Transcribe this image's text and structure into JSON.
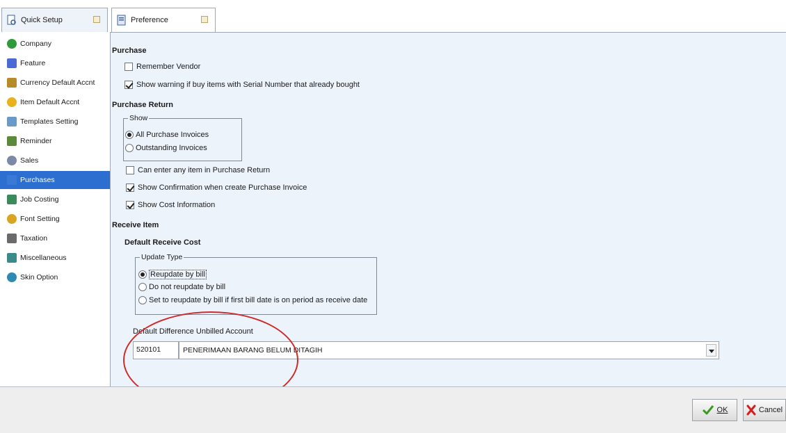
{
  "tabs": [
    {
      "label": "Quick Setup",
      "icon": "quick-setup-icon"
    },
    {
      "label": "Preference",
      "icon": "preference-icon"
    }
  ],
  "sidebar": {
    "items": [
      {
        "label": "Company",
        "icon": "company-icon",
        "color": "#2e9a3c"
      },
      {
        "label": "Feature",
        "icon": "feature-icon",
        "color": "#4a6bd6"
      },
      {
        "label": "Currency Default Accnt",
        "icon": "currency-icon",
        "color": "#b78b2a"
      },
      {
        "label": "Item Default Accnt",
        "icon": "item-star-icon",
        "color": "#e8b21e"
      },
      {
        "label": "Templates Setting",
        "icon": "templates-icon",
        "color": "#6b9ac6"
      },
      {
        "label": "Reminder",
        "icon": "reminder-icon",
        "color": "#5a8a3a"
      },
      {
        "label": "Sales",
        "icon": "sales-icon",
        "color": "#7a8aa6"
      },
      {
        "label": "Purchases",
        "icon": "purchases-icon",
        "color": "#3a7ad6"
      },
      {
        "label": "Job Costing",
        "icon": "job-costing-icon",
        "color": "#3c8a5a"
      },
      {
        "label": "Font Setting",
        "icon": "font-setting-icon",
        "color": "#d9a422"
      },
      {
        "label": "Taxation",
        "icon": "taxation-icon",
        "color": "#6a6a6a"
      },
      {
        "label": "Miscellaneous",
        "icon": "miscellaneous-icon",
        "color": "#3a8a8a"
      },
      {
        "label": "Skin Option",
        "icon": "skin-option-icon",
        "color": "#2e8ab0"
      }
    ],
    "selected": "Purchases"
  },
  "purchase": {
    "heading": "Purchase",
    "remember_vendor": {
      "label": "Remember Vendor",
      "checked": false
    },
    "serial_warning": {
      "label": "Show warning if buy items with Serial Number that already bought",
      "checked": true
    }
  },
  "purchase_return": {
    "heading": "Purchase Return",
    "show_group": "Show",
    "options": [
      {
        "label": "All Purchase Invoices",
        "selected": true
      },
      {
        "label": "Outstanding Invoices",
        "selected": false
      }
    ],
    "any_item": {
      "label": "Can enter any item in Purchase Return",
      "checked": false
    },
    "show_confirmation": {
      "label": "Show Confirmation when create Purchase Invoice",
      "checked": true
    },
    "show_cost": {
      "label": "Show Cost Information",
      "checked": true
    }
  },
  "receive_item": {
    "heading": "Receive Item",
    "subheading": "Default Receive Cost",
    "update_group": "Update Type",
    "options": [
      {
        "label": "Reupdate by bill",
        "selected": true
      },
      {
        "label": "Do not reupdate by bill",
        "selected": false
      },
      {
        "label": "Set to reupdate by bill if first bill date is on period as receive date",
        "selected": false
      }
    ],
    "account_label": "Default Difference Unbilled Account",
    "account_code": "520101",
    "account_name": "PENERIMAAN BARANG BELUM DITAGIH"
  },
  "footer": {
    "ok_label": "OK",
    "cancel_label": "Cancel"
  },
  "colors": {
    "selection": "#2d6fd1",
    "panel": "#edf3fb",
    "annotation": "#cf2a2a"
  }
}
